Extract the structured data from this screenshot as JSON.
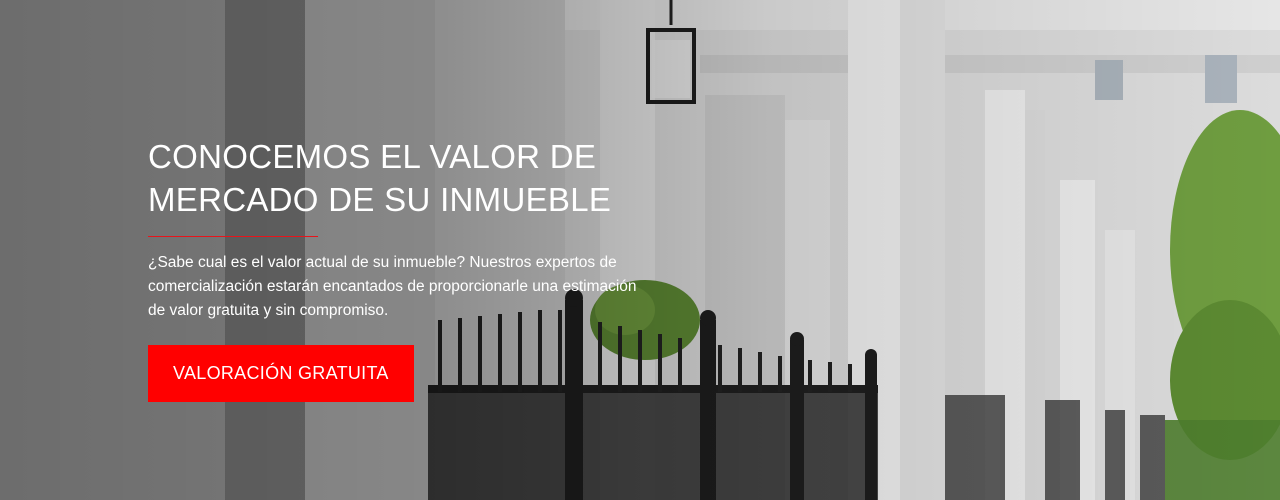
{
  "hero": {
    "title_line1": "CONOCEMOS EL VALOR DE",
    "title_line2": "MERCADO DE SU INMUEBLE",
    "description": "¿Sabe cual es el valor actual de su inmueble? Nuestros expertos de comercialización estarán encantados de proporcionarle una estimación de valor gratuita y sin compromiso.",
    "cta_label": "VALORACIÓN GRATUITA",
    "colors": {
      "accent": "#ff0000",
      "divider": "#e8141b",
      "text": "#ffffff"
    }
  }
}
